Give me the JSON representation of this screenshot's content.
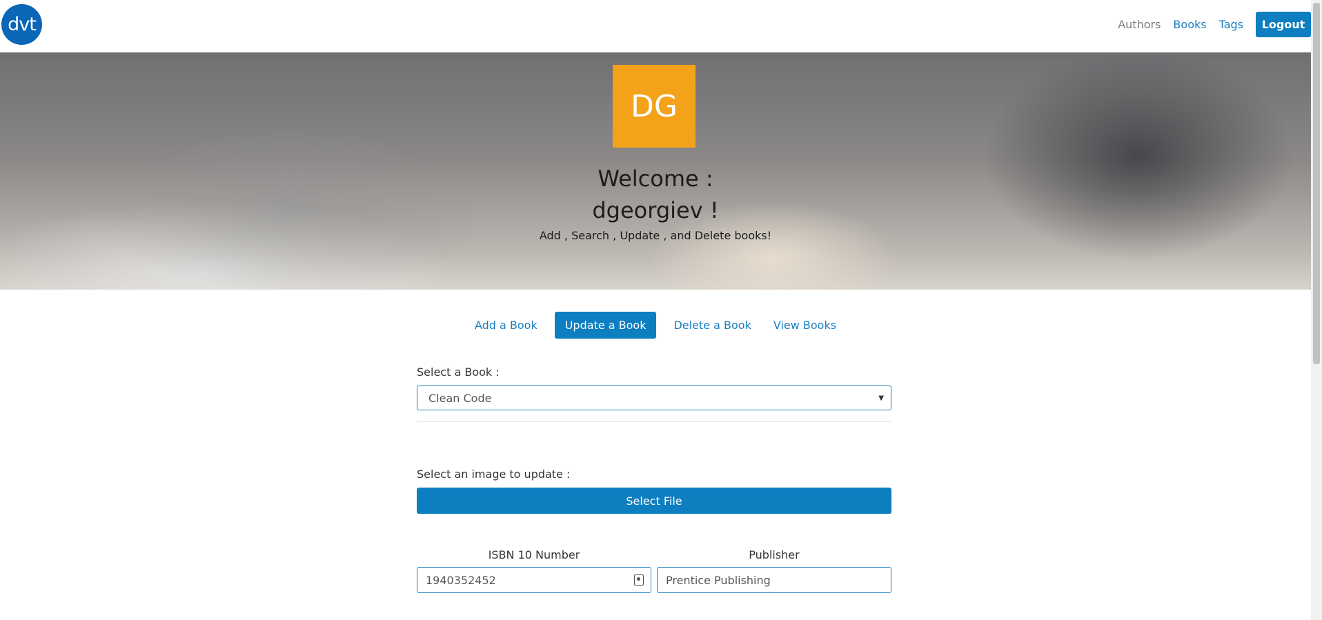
{
  "header": {
    "logo_text": "dvt",
    "nav": {
      "authors": "Authors",
      "books": "Books",
      "tags": "Tags"
    },
    "logout_label": "Logout"
  },
  "hero": {
    "avatar_initials": "DG",
    "welcome_line1": "Welcome :",
    "welcome_line2": "dgeorgiev !",
    "tagline": "Add , Search , Update , and Delete books!"
  },
  "tabs": {
    "add": "Add a Book",
    "update": "Update a Book",
    "delete": "Delete a Book",
    "view": "View Books",
    "active": "Update a Book"
  },
  "form": {
    "select_book_label": "Select a Book :",
    "selected_book": "Clean Code",
    "image_label": "Select an image to update :",
    "select_file_label": "Select File",
    "isbn_label": "ISBN 10 Number",
    "isbn_value": "1940352452",
    "publisher_label": "Publisher",
    "publisher_value": "Prentice Publishing"
  },
  "colors": {
    "primary": "#0d7ec0",
    "link": "#1a7fc1",
    "avatar_bg": "#f3a21a",
    "logo_bg": "#0a66b6"
  }
}
